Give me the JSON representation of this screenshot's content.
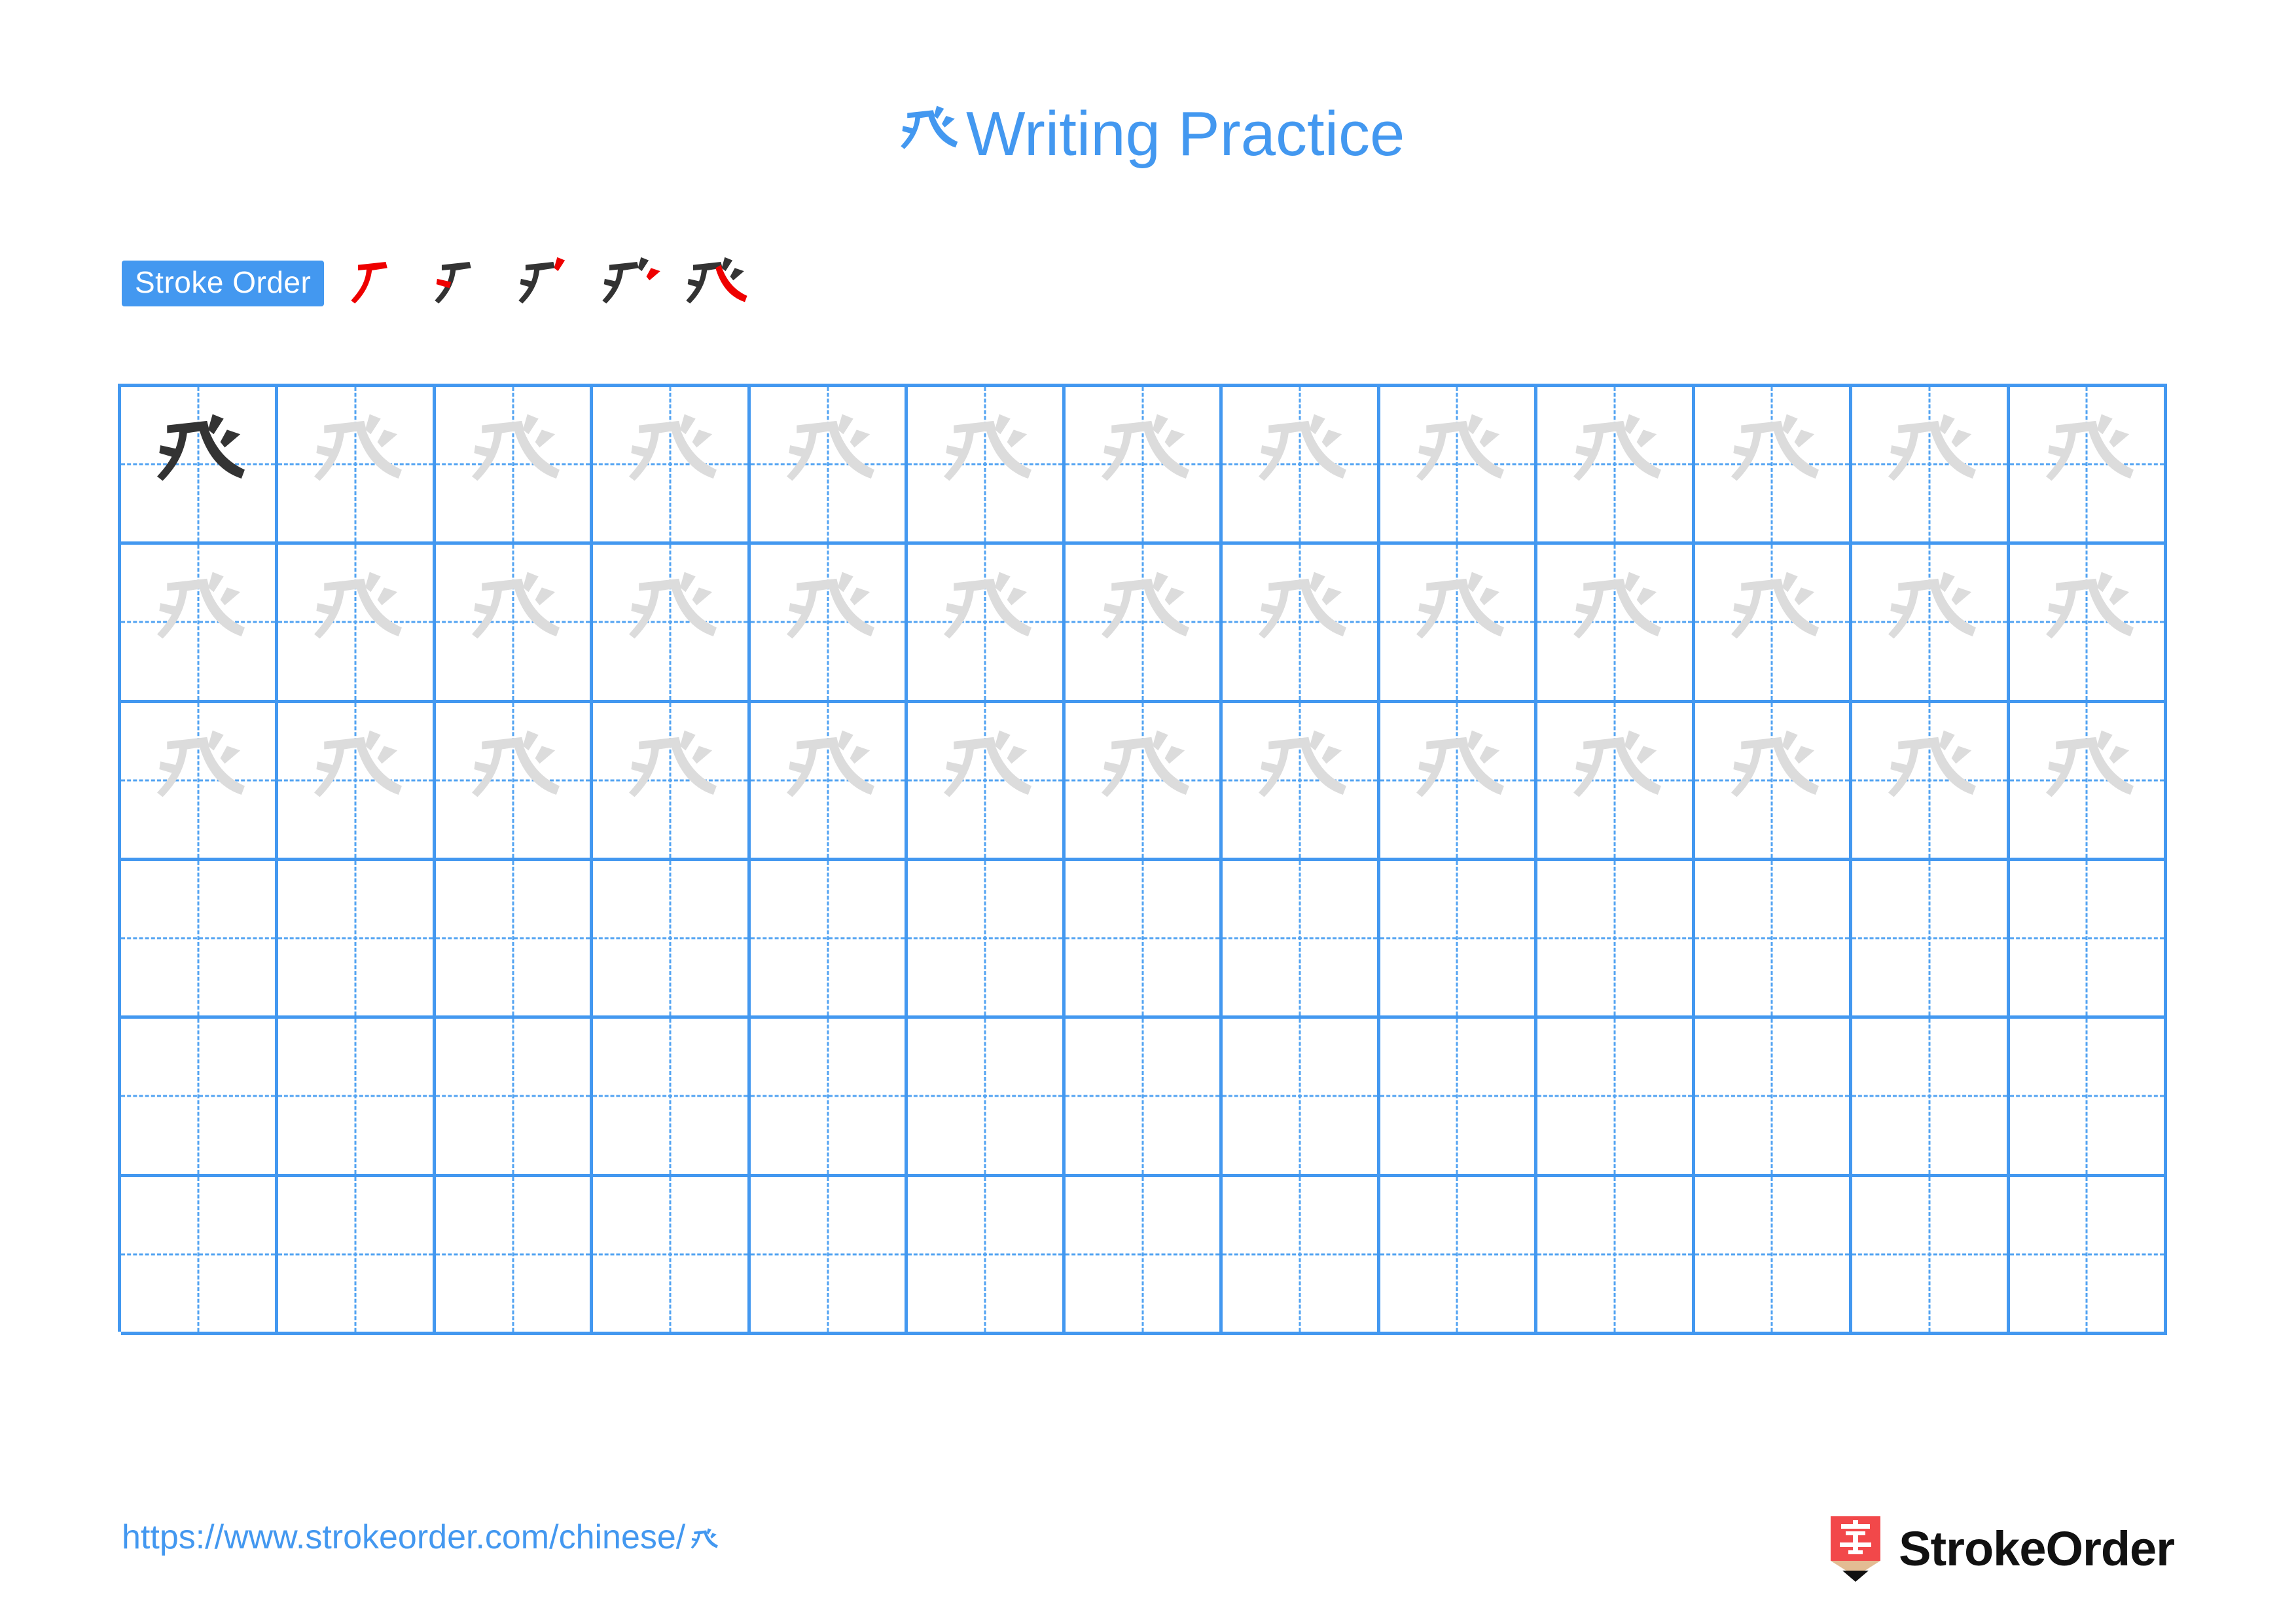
{
  "document": {
    "type": "chinese-character-writing-practice-worksheet",
    "background_color": "#ffffff",
    "accent_color": "#4398f0",
    "ink_color": "#333333",
    "trace_color": "#dcdcdc",
    "highlight_stroke_color": "#ee0000"
  },
  "title": {
    "character": "𠁼",
    "text": "Writing Practice",
    "color": "#4398f0"
  },
  "stroke_order": {
    "badge_label": "Stroke Order",
    "badge_bg": "#4398f0",
    "badge_text_color": "#ffffff",
    "stroke_count": 5,
    "steps": [
      {
        "index": 1,
        "strokes_drawn": 1,
        "new_stroke_color": "#ee0000",
        "prior_stroke_color": "#333333"
      },
      {
        "index": 2,
        "strokes_drawn": 2,
        "new_stroke_color": "#ee0000",
        "prior_stroke_color": "#333333"
      },
      {
        "index": 3,
        "strokes_drawn": 3,
        "new_stroke_color": "#ee0000",
        "prior_stroke_color": "#333333"
      },
      {
        "index": 4,
        "strokes_drawn": 4,
        "new_stroke_color": "#ee0000",
        "prior_stroke_color": "#333333"
      },
      {
        "index": 5,
        "strokes_drawn": 5,
        "new_stroke_color": "#ee0000",
        "prior_stroke_color": "#333333"
      }
    ]
  },
  "grid": {
    "columns": 13,
    "rows": 6,
    "line_color": "#4398f0",
    "guide_color": "#52a3f2",
    "rows_data": [
      {
        "row": 1,
        "cells": [
          "dark",
          "trace",
          "trace",
          "trace",
          "trace",
          "trace",
          "trace",
          "trace",
          "trace",
          "trace",
          "trace",
          "trace",
          "trace"
        ]
      },
      {
        "row": 2,
        "cells": [
          "trace",
          "trace",
          "trace",
          "trace",
          "trace",
          "trace",
          "trace",
          "trace",
          "trace",
          "trace",
          "trace",
          "trace",
          "trace"
        ]
      },
      {
        "row": 3,
        "cells": [
          "trace",
          "trace",
          "trace",
          "trace",
          "trace",
          "trace",
          "trace",
          "trace",
          "trace",
          "trace",
          "trace",
          "trace",
          "trace"
        ]
      },
      {
        "row": 4,
        "cells": [
          "empty",
          "empty",
          "empty",
          "empty",
          "empty",
          "empty",
          "empty",
          "empty",
          "empty",
          "empty",
          "empty",
          "empty",
          "empty"
        ]
      },
      {
        "row": 5,
        "cells": [
          "empty",
          "empty",
          "empty",
          "empty",
          "empty",
          "empty",
          "empty",
          "empty",
          "empty",
          "empty",
          "empty",
          "empty",
          "empty"
        ]
      },
      {
        "row": 6,
        "cells": [
          "empty",
          "empty",
          "empty",
          "empty",
          "empty",
          "empty",
          "empty",
          "empty",
          "empty",
          "empty",
          "empty",
          "empty",
          "empty"
        ]
      }
    ]
  },
  "footer": {
    "url_text": "https://www.strokeorder.com/chinese/",
    "url_character": "𠁼",
    "url_color": "#4398f0",
    "brand_name": "StrokeOrder",
    "brand_mark_character": "字",
    "brand_mark_body_color": "#f2484a",
    "brand_mark_wood_color": "#e3bc93",
    "brand_mark_tip_color": "#111111",
    "brand_text_color": "#111111"
  }
}
